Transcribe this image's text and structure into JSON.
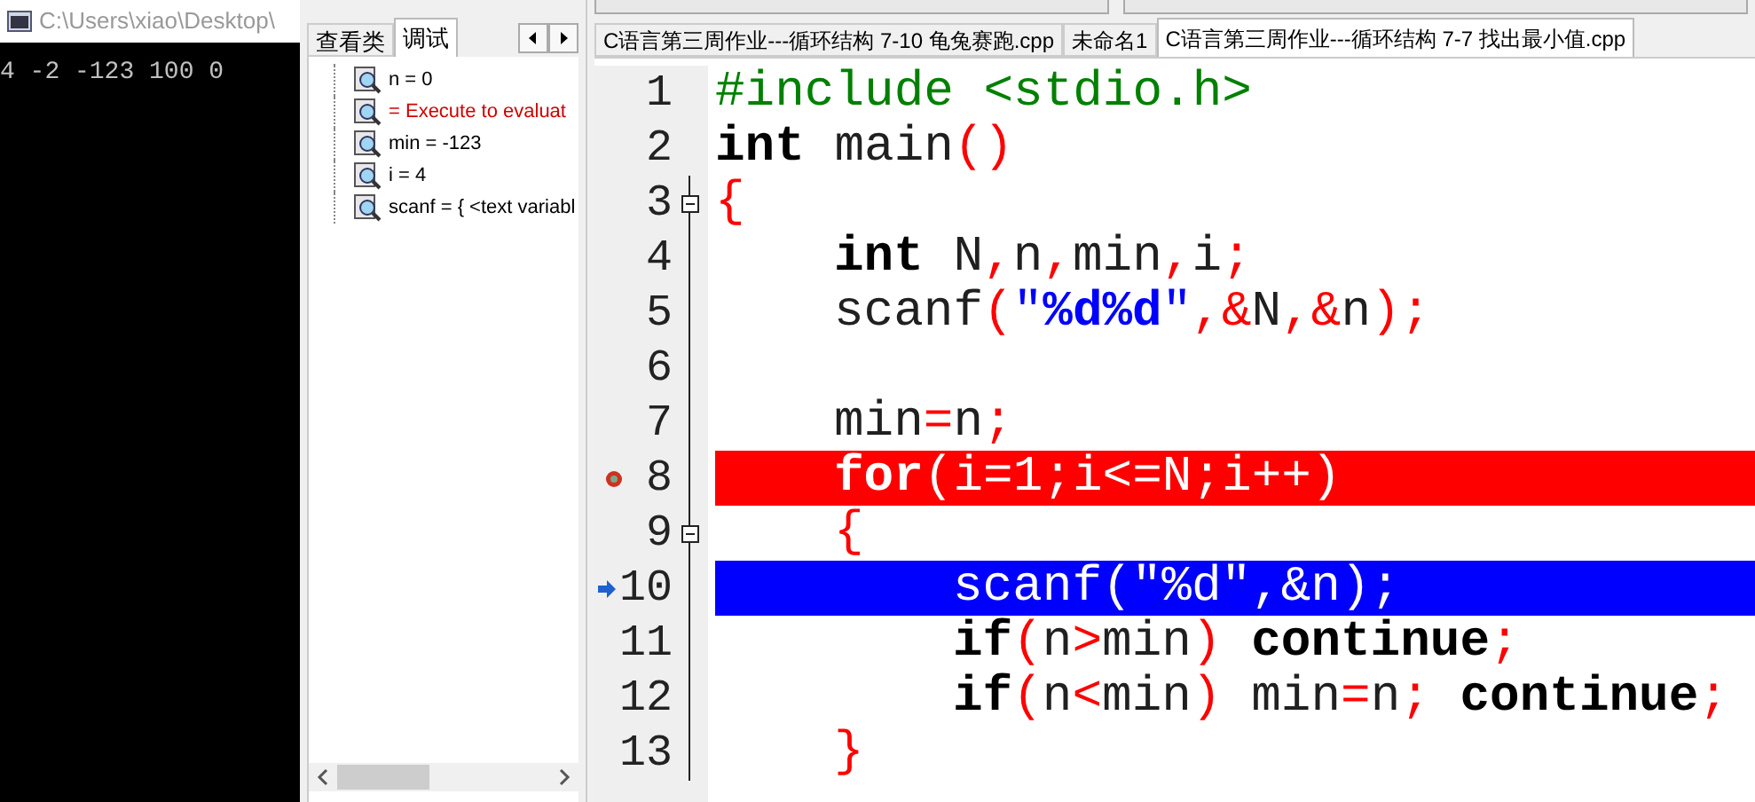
{
  "console": {
    "title": "C:\\Users\\xiao\\Desktop\\",
    "output": "4 -2 -123 100 0"
  },
  "side_panel": {
    "tabs": [
      {
        "label": "查看类",
        "selected": false
      },
      {
        "label": "调试",
        "selected": true
      }
    ],
    "watches": [
      {
        "text": "n = 0",
        "kind": "value"
      },
      {
        "text": " = Execute to evaluat",
        "kind": "error"
      },
      {
        "text": "min = -123",
        "kind": "value"
      },
      {
        "text": "i = 4",
        "kind": "value"
      },
      {
        "text": "scanf = { <text variabl",
        "kind": "value"
      }
    ]
  },
  "editor": {
    "tabs": [
      {
        "label": "C语言第三周作业---循环结构 7-10 龟兔赛跑.cpp",
        "selected": false
      },
      {
        "label": "未命名1",
        "selected": false
      },
      {
        "label": "C语言第三周作业---循环结构 7-7 找出最小值.cpp",
        "selected": true
      }
    ],
    "lines": [
      {
        "number": "1",
        "breakpoint": false,
        "current": false,
        "tokens": [
          {
            "kind": "preproc",
            "text": "#include <stdio.h>"
          }
        ]
      },
      {
        "number": "2",
        "breakpoint": false,
        "current": false,
        "tokens": [
          {
            "kind": "keyword",
            "text": "int"
          },
          {
            "kind": "plain",
            "text": " main"
          },
          {
            "kind": "punct",
            "text": "()"
          }
        ]
      },
      {
        "number": "3",
        "breakpoint": false,
        "current": false,
        "fold": true,
        "tokens": [
          {
            "kind": "punct",
            "text": "{"
          }
        ],
        "children": [
          {
            "number": "4",
            "breakpoint": false,
            "current": false,
            "tokens": [
              {
                "kind": "keyword",
                "text": "int"
              },
              {
                "kind": "plain",
                "text": " N"
              },
              {
                "kind": "punct",
                "text": ","
              },
              {
                "kind": "plain",
                "text": "n"
              },
              {
                "kind": "punct",
                "text": ","
              },
              {
                "kind": "plain",
                "text": "min"
              },
              {
                "kind": "punct",
                "text": ","
              },
              {
                "kind": "plain",
                "text": "i"
              },
              {
                "kind": "punct",
                "text": ";"
              }
            ]
          },
          {
            "number": "5",
            "breakpoint": false,
            "current": false,
            "tokens": [
              {
                "kind": "plain",
                "text": "scanf"
              },
              {
                "kind": "punct",
                "text": "("
              },
              {
                "kind": "string",
                "text": "\""
              },
              {
                "kind": "format",
                "text": "%d%d"
              },
              {
                "kind": "string",
                "text": "\""
              },
              {
                "kind": "punct",
                "text": ",&"
              },
              {
                "kind": "plain",
                "text": "N"
              },
              {
                "kind": "punct",
                "text": ",&"
              },
              {
                "kind": "plain",
                "text": "n"
              },
              {
                "kind": "punct",
                "text": ");"
              }
            ]
          },
          {
            "number": "6",
            "breakpoint": false,
            "current": false
          },
          {
            "number": "7",
            "breakpoint": false,
            "current": false,
            "tokens": [
              {
                "kind": "plain",
                "text": "min"
              },
              {
                "kind": "punct",
                "text": "="
              },
              {
                "kind": "plain",
                "text": "n"
              },
              {
                "kind": "punct",
                "text": ";"
              }
            ]
          },
          {
            "number": "8",
            "breakpoint": true,
            "current": false,
            "tokens": [
              {
                "kind": "keyword",
                "text": "for"
              },
              {
                "kind": "punct",
                "text": "("
              },
              {
                "kind": "plain",
                "text": "i"
              },
              {
                "kind": "punct",
                "text": "="
              },
              {
                "kind": "plain",
                "text": "1"
              },
              {
                "kind": "punct",
                "text": ";"
              },
              {
                "kind": "plain",
                "text": "i"
              },
              {
                "kind": "punct",
                "text": "<="
              },
              {
                "kind": "plain",
                "text": "N"
              },
              {
                "kind": "punct",
                "text": ";"
              },
              {
                "kind": "plain",
                "text": "i"
              },
              {
                "kind": "punct",
                "text": "++)"
              }
            ]
          },
          {
            "number": "9",
            "breakpoint": false,
            "current": false,
            "fold": true,
            "tokens": [
              {
                "kind": "punct",
                "text": "{"
              }
            ],
            "children": [
              {
                "number": "10",
                "breakpoint": false,
                "current": true,
                "tokens": [
                  {
                    "kind": "plain",
                    "text": "scanf"
                  },
                  {
                    "kind": "punct",
                    "text": "("
                  },
                  {
                    "kind": "string",
                    "text": "\""
                  },
                  {
                    "kind": "format",
                    "text": "%d"
                  },
                  {
                    "kind": "string",
                    "text": "\""
                  },
                  {
                    "kind": "punct",
                    "text": ",&"
                  },
                  {
                    "kind": "plain",
                    "text": "n"
                  },
                  {
                    "kind": "punct",
                    "text": ");"
                  }
                ]
              },
              {
                "number": "11",
                "breakpoint": false,
                "current": false,
                "tokens": [
                  {
                    "kind": "keyword",
                    "text": "if"
                  },
                  {
                    "kind": "punct",
                    "text": "("
                  },
                  {
                    "kind": "plain",
                    "text": "n"
                  },
                  {
                    "kind": "punct",
                    "text": ">"
                  },
                  {
                    "kind": "plain",
                    "text": "min"
                  },
                  {
                    "kind": "punct",
                    "text": ")"
                  },
                  {
                    "kind": "keyword",
                    "text": " continue"
                  },
                  {
                    "kind": "punct",
                    "text": ";"
                  }
                ]
              },
              {
                "number": "12",
                "breakpoint": false,
                "current": false,
                "tokens": [
                  {
                    "kind": "keyword",
                    "text": "if"
                  },
                  {
                    "kind": "punct",
                    "text": "("
                  },
                  {
                    "kind": "plain",
                    "text": "n"
                  },
                  {
                    "kind": "punct",
                    "text": "<"
                  },
                  {
                    "kind": "plain",
                    "text": "min"
                  },
                  {
                    "kind": "punct",
                    "text": ")"
                  },
                  {
                    "kind": "plain",
                    "text": " min"
                  },
                  {
                    "kind": "punct",
                    "text": "="
                  },
                  {
                    "kind": "plain",
                    "text": "n"
                  },
                  {
                    "kind": "punct",
                    "text": ";"
                  },
                  {
                    "kind": "keyword",
                    "text": " continue"
                  },
                  {
                    "kind": "punct",
                    "text": ";"
                  }
                ]
              }
            ]
          },
          {
            "number": "13",
            "breakpoint": false,
            "current": false,
            "tokens": [
              {
                "kind": "punct",
                "text": "}"
              }
            ]
          }
        ]
      }
    ]
  }
}
